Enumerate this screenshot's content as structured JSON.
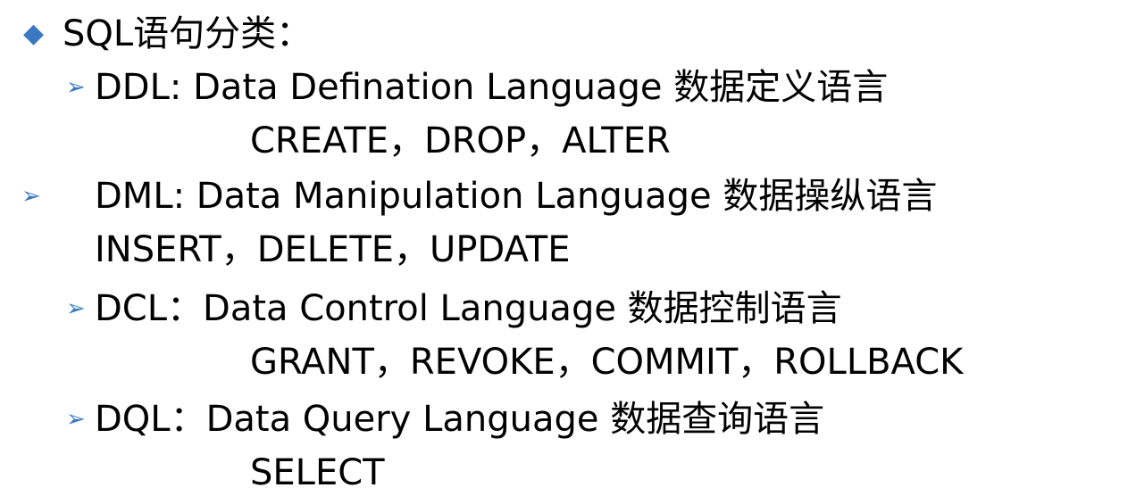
{
  "title": {
    "text": "SQL语句分类："
  },
  "items": [
    {
      "heading": "DDL: Data Defination Language 数据定义语言",
      "commands": "CREATE，DROP，ALTER"
    },
    {
      "heading": "DML: Data Manipulation Language 数据操纵语言",
      "commands": "INSERT，DELETE，UPDATE"
    },
    {
      "heading": "DCL：Data Control Language 数据控制语言",
      "commands": "GRANT，REVOKE，COMMIT，ROLLBACK"
    },
    {
      "heading": "DQL：Data Query Language 数据查询语言",
      "commands": "SELECT"
    }
  ],
  "icons": {
    "title_bullet": "diamond-bullet-icon",
    "item_bullet": "arrow-bullet-icon"
  },
  "colors": {
    "bullet": "#3a78c2",
    "text": "#000000",
    "background": "#ffffff"
  }
}
